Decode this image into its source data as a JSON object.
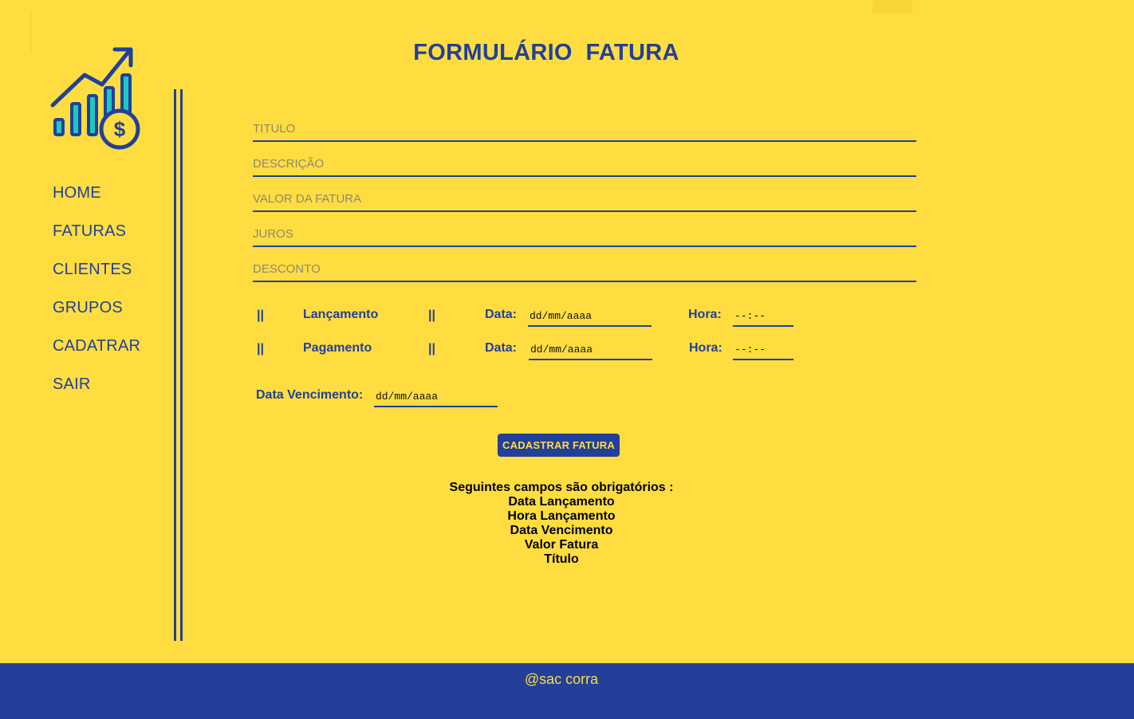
{
  "colors": {
    "background": "#FFDD40",
    "primary": "#22409A",
    "accent_teal": "#1CC9C0"
  },
  "logo": {
    "icon": "growth-chart-dollar-icon"
  },
  "nav": {
    "items": [
      {
        "label": "HOME"
      },
      {
        "label": "FATURAS"
      },
      {
        "label": "CLIENTES"
      },
      {
        "label": "GRUPOS"
      },
      {
        "label": "CADATRAR"
      },
      {
        "label": "SAIR"
      }
    ]
  },
  "form": {
    "title": "FORMULÁRIO  FATURA",
    "fields": [
      {
        "placeholder": "TITULO"
      },
      {
        "placeholder": "DESCRIÇÃO"
      },
      {
        "placeholder": "VALOR DA FATURA"
      },
      {
        "placeholder": "JUROS"
      },
      {
        "placeholder": "DESCONTO"
      }
    ],
    "pipe": "||",
    "lancamento": {
      "label": "Lançamento",
      "date_label": "Data:",
      "date_value": "dd/mm/aaaa",
      "time_label": "Hora:",
      "time_value": "--:--"
    },
    "pagamento": {
      "label": "Pagamento",
      "date_label": "Data:",
      "date_value": "dd/mm/aaaa",
      "time_label": "Hora:",
      "time_value": "--:--"
    },
    "vencimento": {
      "label": "Data Vencimento:",
      "date_value": "dd/mm/aaaa"
    },
    "submit_label": "CADASTRAR FATURA"
  },
  "required": {
    "heading": "Seguintes campos são obrigatórios :",
    "items": [
      "Data Lançamento",
      "Hora Lançamento",
      "Data Vencimento",
      "Valor Fatura",
      "Título"
    ]
  },
  "footer": {
    "text": "@sac corra"
  }
}
